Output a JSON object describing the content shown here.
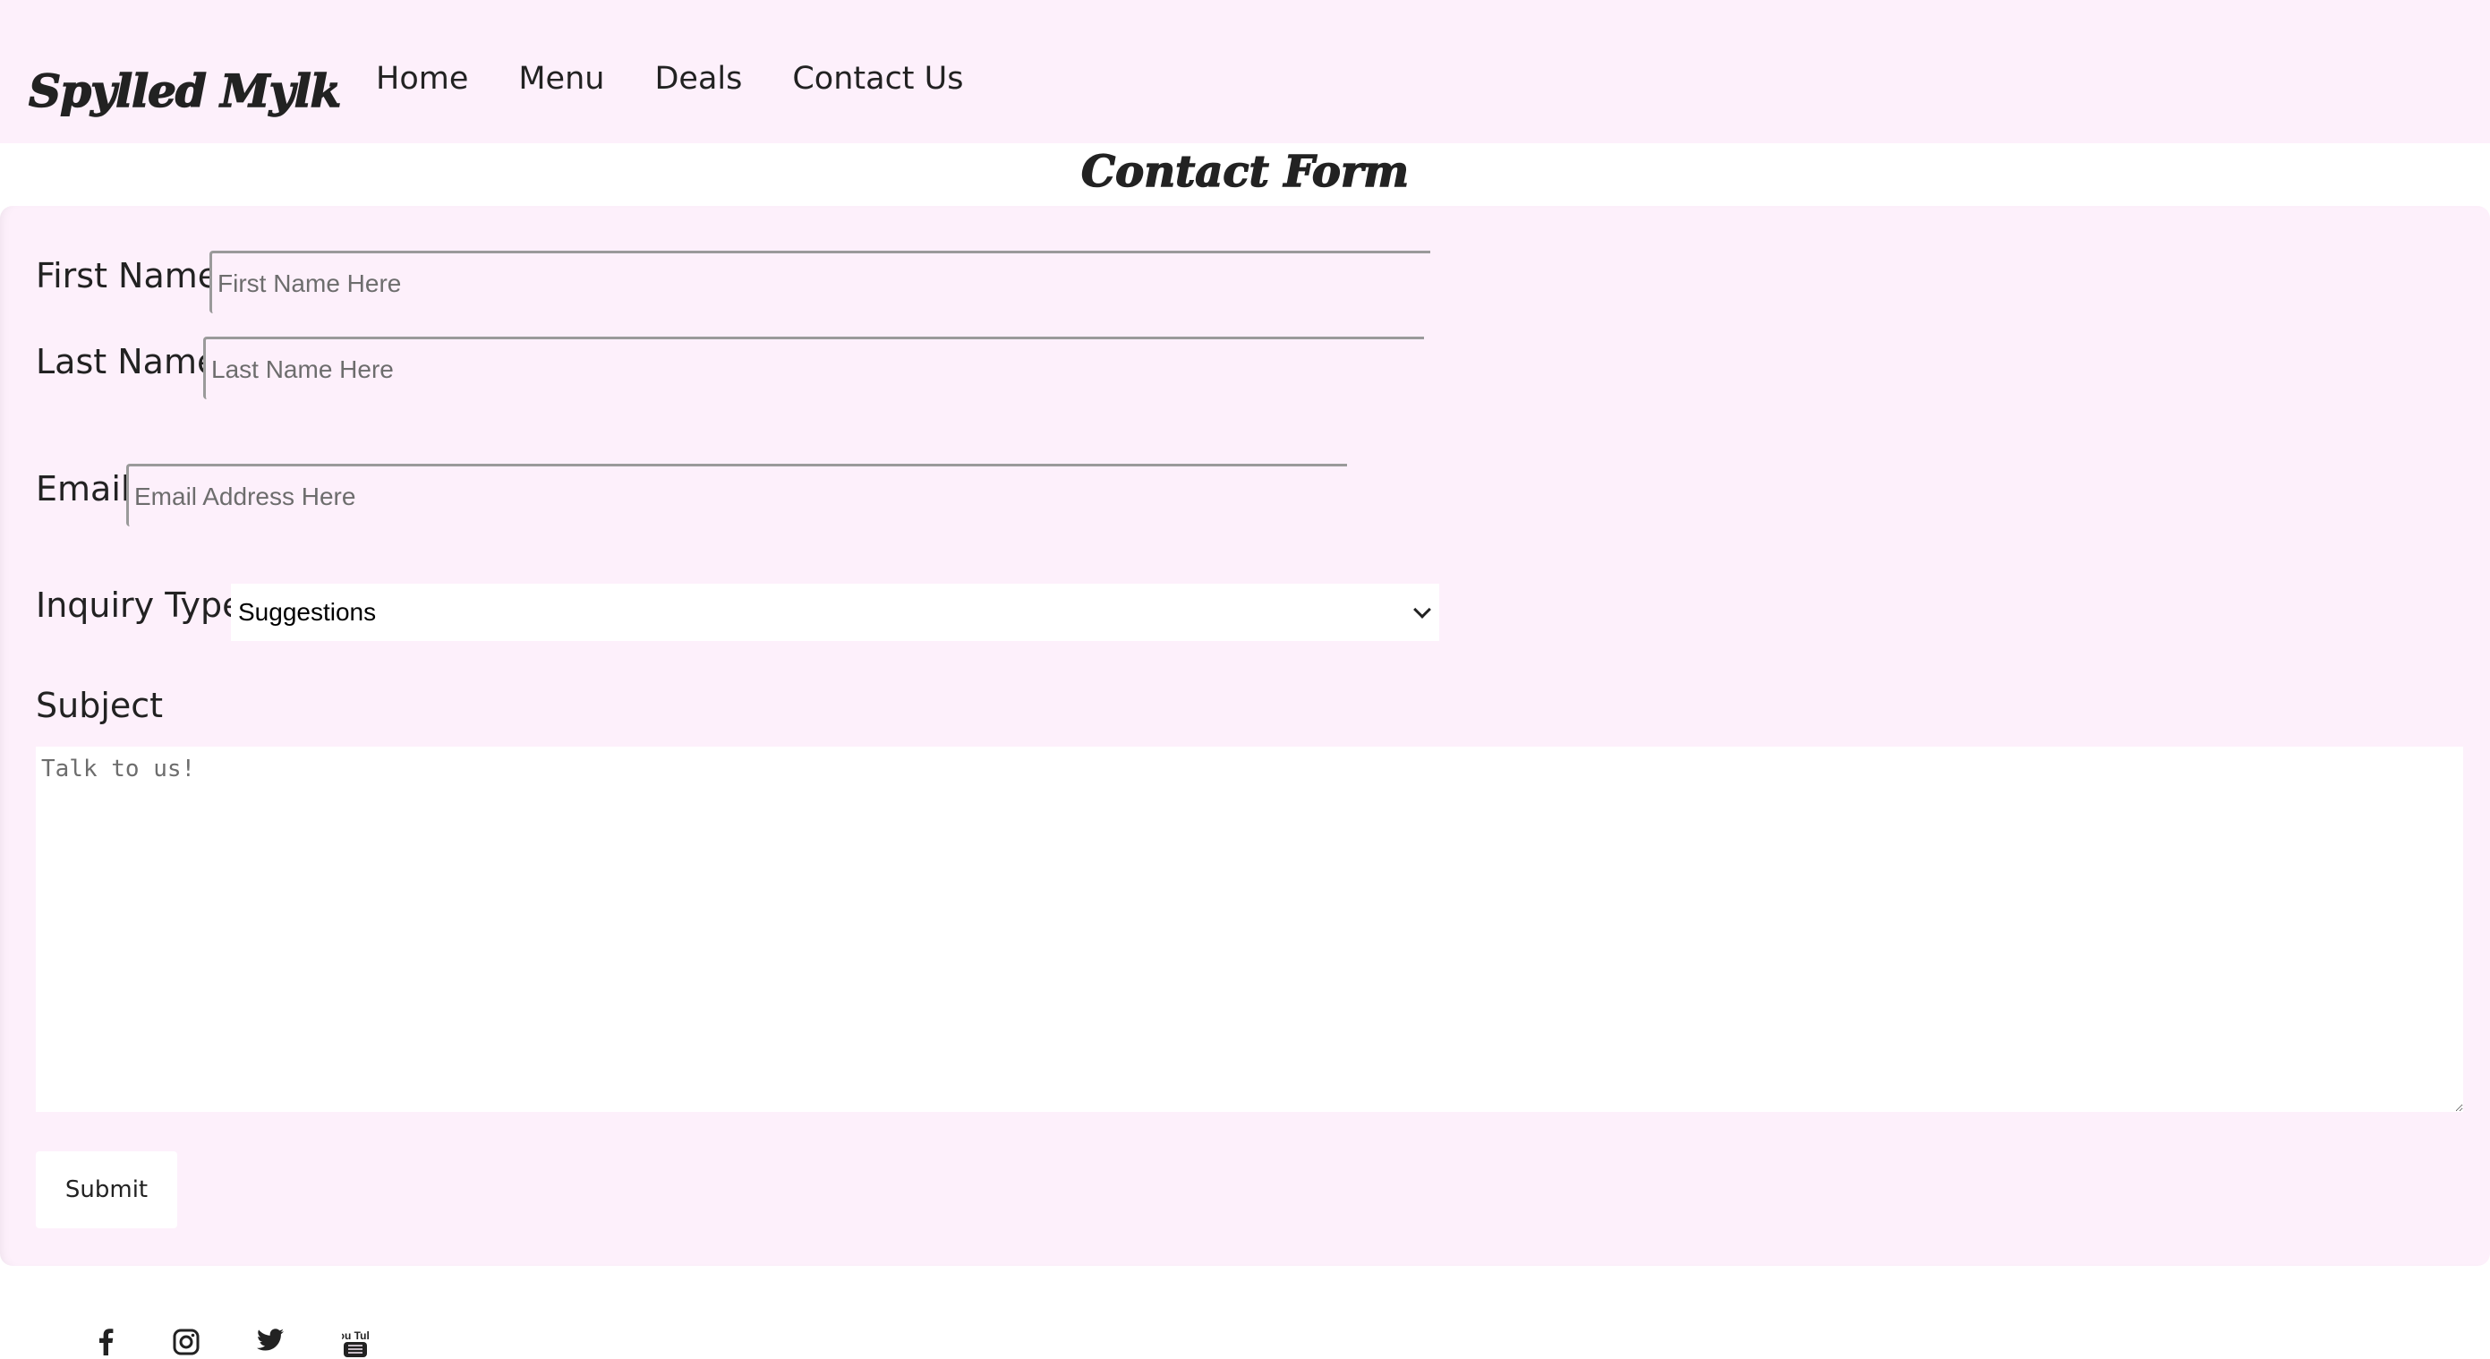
{
  "header": {
    "logo": "Spylled Mylk",
    "nav": [
      {
        "label": "Home"
      },
      {
        "label": "Menu"
      },
      {
        "label": "Deals"
      },
      {
        "label": "Contact Us"
      }
    ]
  },
  "page_title": "Contact Form",
  "form": {
    "first_name": {
      "label": "First Name",
      "placeholder": "First Name Here",
      "value": ""
    },
    "last_name": {
      "label": "Last Name",
      "placeholder": "Last Name Here",
      "value": ""
    },
    "email": {
      "label": "Email",
      "placeholder": "Email Address Here",
      "value": ""
    },
    "inquiry_type": {
      "label": "Inquiry Type",
      "selected": "Suggestions"
    },
    "subject": {
      "label": "Subject",
      "placeholder": "Talk to us!",
      "value": ""
    },
    "submit_label": "Submit"
  },
  "footer": {
    "social_icons": [
      "facebook-icon",
      "instagram-icon",
      "twitter-icon",
      "youtube-icon"
    ],
    "youtube_text": "You Tube"
  },
  "colors": {
    "panel_background": "#fdf0fb",
    "text": "#222222",
    "field_background": "#ffffff"
  }
}
